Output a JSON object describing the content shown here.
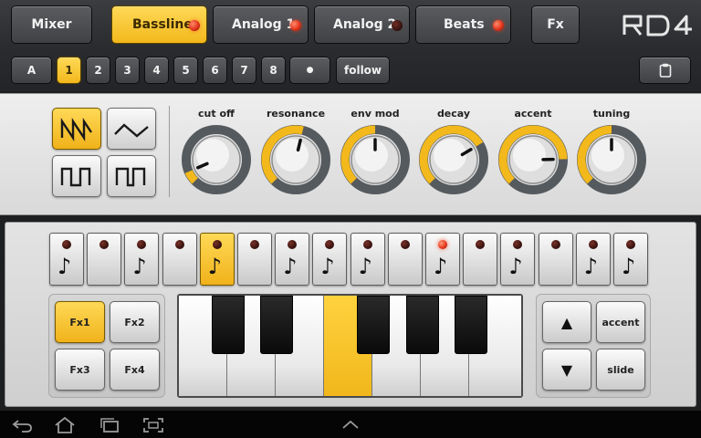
{
  "tracks": {
    "mixer": "Mixer",
    "bassline": "Bassline",
    "analog1": "Analog 1",
    "analog2": "Analog 2",
    "beats": "Beats",
    "fx": "Fx"
  },
  "logo_text": "RD4",
  "patterns": {
    "bank": "A",
    "numbers": [
      "1",
      "2",
      "3",
      "4",
      "5",
      "6",
      "7",
      "8"
    ],
    "selected": "1",
    "dot": "●",
    "follow": "follow"
  },
  "synth": {
    "knobs": [
      {
        "label": "cut off",
        "value": 0.08
      },
      {
        "label": "resonance",
        "value": 0.55
      },
      {
        "label": "env mod",
        "value": 0.5
      },
      {
        "label": "decay",
        "value": 0.72
      },
      {
        "label": "accent",
        "value": 0.83
      },
      {
        "label": "tuning",
        "value": 0.5
      }
    ]
  },
  "sequencer": {
    "steps": [
      {
        "note": true,
        "active": false,
        "led": false
      },
      {
        "note": false,
        "active": false,
        "led": false
      },
      {
        "note": true,
        "active": false,
        "led": false
      },
      {
        "note": false,
        "active": false,
        "led": false
      },
      {
        "note": true,
        "active": true,
        "led": false
      },
      {
        "note": false,
        "active": false,
        "led": false
      },
      {
        "note": true,
        "active": false,
        "led": false
      },
      {
        "note": true,
        "active": false,
        "led": false
      },
      {
        "note": true,
        "active": false,
        "led": false
      },
      {
        "note": false,
        "active": false,
        "led": false
      },
      {
        "note": true,
        "active": false,
        "led": true
      },
      {
        "note": false,
        "active": false,
        "led": false
      },
      {
        "note": true,
        "active": false,
        "led": false
      },
      {
        "note": false,
        "active": false,
        "led": false
      },
      {
        "note": true,
        "active": false,
        "led": false
      },
      {
        "note": true,
        "active": false,
        "led": false
      }
    ],
    "note_glyph": "♪"
  },
  "fx_buttons": [
    "Fx1",
    "Fx2",
    "Fx3",
    "Fx4"
  ],
  "controls": {
    "up": "▲",
    "down": "▼",
    "accent": "accent",
    "slide": "slide"
  },
  "colors": {
    "accent_yellow": "#f2b81c",
    "led_red": "#e2351c"
  }
}
